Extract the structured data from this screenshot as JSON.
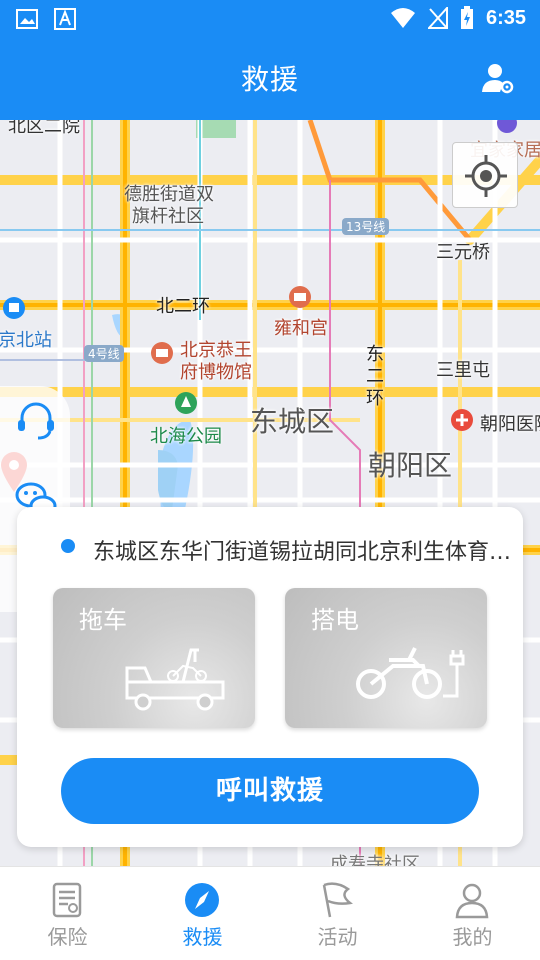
{
  "status_bar": {
    "time": "6:35"
  },
  "header": {
    "title": "救援"
  },
  "map": {
    "labels": {
      "l1": "北区二院",
      "l2": "德胜街道双",
      "l3": "旗杆社区",
      "l4": "宜家家居",
      "l5": "13号线",
      "l6": "三元桥",
      "l7": "北二环",
      "l8": "雍和宫",
      "l9": "京北站",
      "l10": "4号线",
      "l11": "北京恭王",
      "l12": "府博物馆",
      "l13": "东",
      "l14": "二",
      "l15": "环",
      "l16": "三里屯",
      "l17": "北海公园",
      "l18": "东城区",
      "l19": "朝阳医院",
      "l20": "朝阳区",
      "l21": "成寿寺社区"
    }
  },
  "panel": {
    "address": "东城区东华门街道锡拉胡同北京利生体育商厦",
    "service_tow": "拖车",
    "service_jump": "搭电",
    "call_button": "呼叫救援"
  },
  "tabs": [
    {
      "label": "保险",
      "icon": "document-icon"
    },
    {
      "label": "救援",
      "icon": "compass-icon"
    },
    {
      "label": "活动",
      "icon": "flag-icon"
    },
    {
      "label": "我的",
      "icon": "person-icon"
    }
  ],
  "colors": {
    "primary": "#1a8cf5",
    "tab_inactive": "#9a9a9a"
  }
}
